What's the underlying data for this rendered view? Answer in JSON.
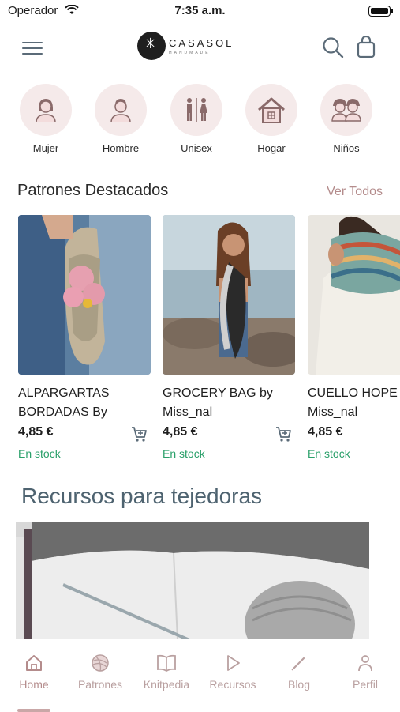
{
  "status_bar": {
    "carrier": "Operador",
    "time": "7:35 a.m."
  },
  "header": {
    "logo_text": "CASASOL",
    "logo_sub": "HANDMADE"
  },
  "categories": [
    {
      "label": "Mujer",
      "icon": "woman-icon"
    },
    {
      "label": "Hombre",
      "icon": "man-icon"
    },
    {
      "label": "Unisex",
      "icon": "unisex-icon"
    },
    {
      "label": "Hogar",
      "icon": "home-icon"
    },
    {
      "label": "Niños",
      "icon": "kids-icon"
    }
  ],
  "featured": {
    "title": "Patrones Destacados",
    "see_all": "Ver Todos",
    "products": [
      {
        "name": "ALPARGARTAS BORDADAS By",
        "price": "4,85 €",
        "stock": "En stock"
      },
      {
        "name": "GROCERY BAG by Miss_nal",
        "price": "4,85 €",
        "stock": "En stock"
      },
      {
        "name": "CUELLO HOPE Miss_nal",
        "price": "4,85 €",
        "stock": "En stock"
      }
    ]
  },
  "resources": {
    "title": "Recursos para tejedoras"
  },
  "tabbar": [
    {
      "label": "Home",
      "icon": "house-icon",
      "active": true
    },
    {
      "label": "Patrones",
      "icon": "yarn-ball-icon",
      "active": false
    },
    {
      "label": "Knitpedia",
      "icon": "book-icon",
      "active": false
    },
    {
      "label": "Recursos",
      "icon": "play-icon",
      "active": false
    },
    {
      "label": "Blog",
      "icon": "pencil-icon",
      "active": false
    },
    {
      "label": "Perfil",
      "icon": "person-icon",
      "active": false
    }
  ],
  "colors": {
    "accent": "#b48c8c",
    "stock": "#2aa06a",
    "category_bg": "#f5eaea",
    "heading": "#4e6370"
  }
}
